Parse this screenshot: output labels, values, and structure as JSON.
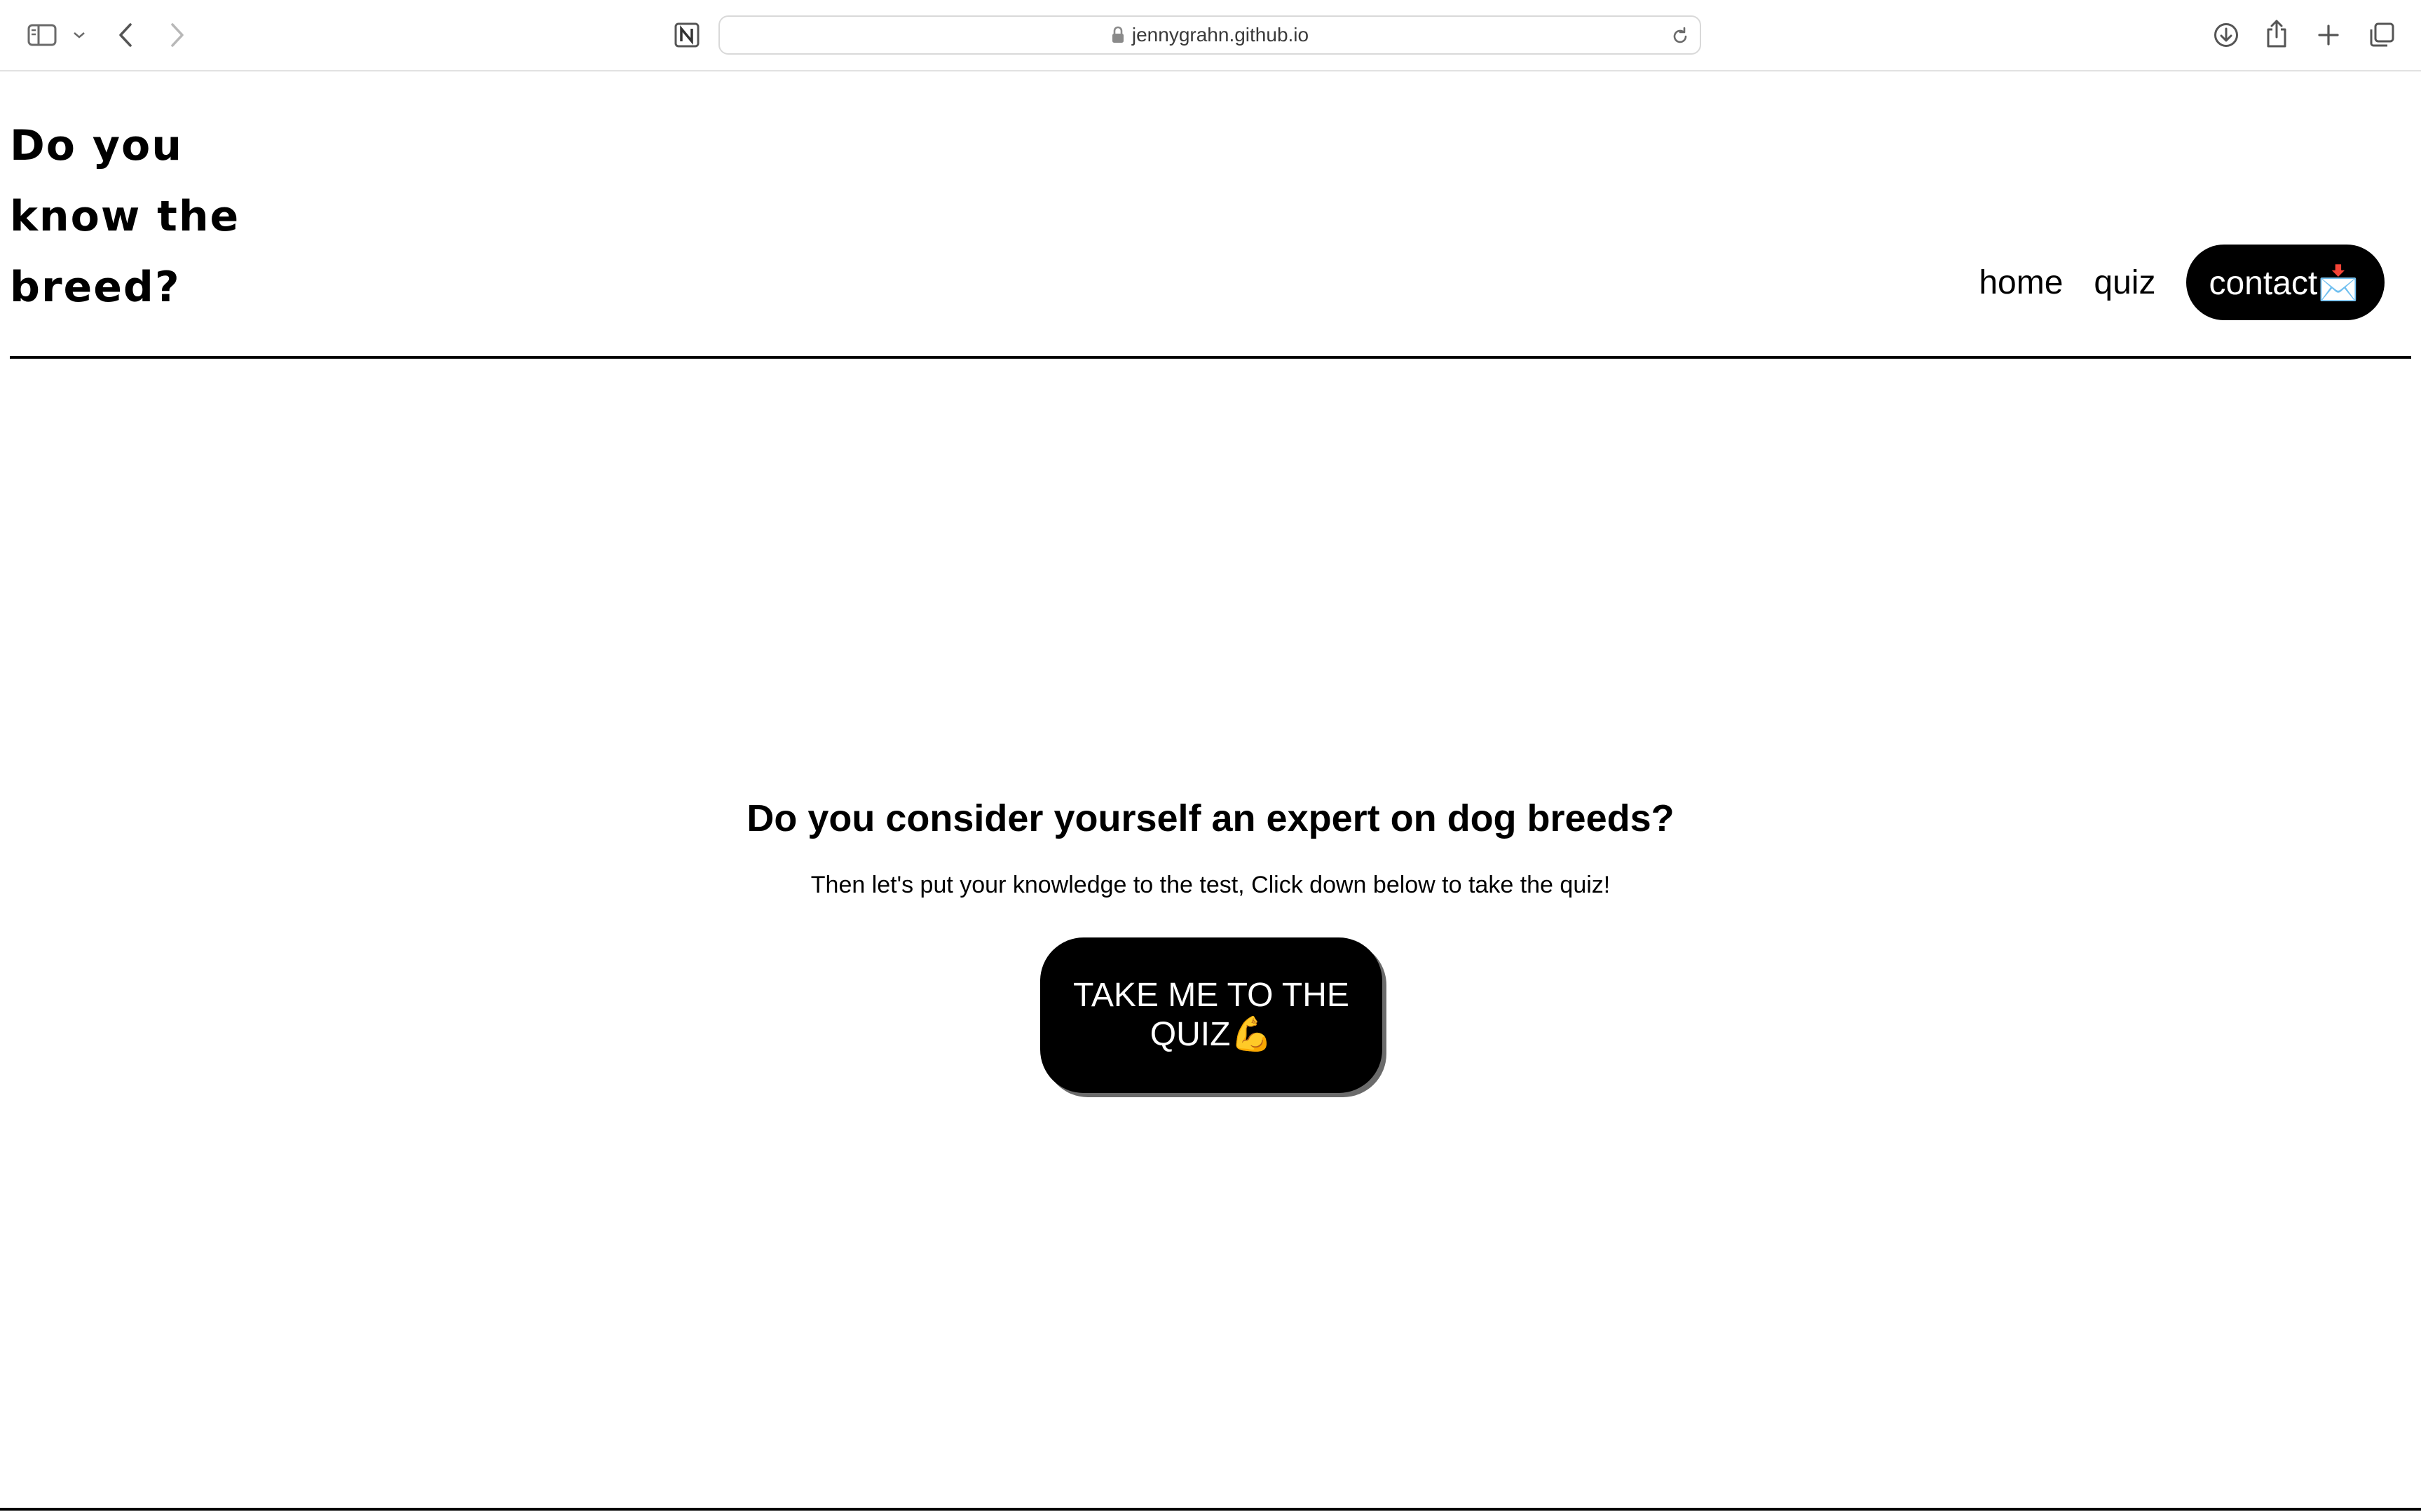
{
  "browser": {
    "address": "jennygrahn.github.io",
    "icons": {
      "sidebar": "sidebar-icon",
      "sidebar_menu": "chevron-down-icon",
      "back": "back-icon",
      "forward": "forward-icon",
      "extension": "notion-icon",
      "lock": "lock-icon",
      "reload": "reload-icon",
      "downloads": "download-icon",
      "share": "share-icon",
      "new_tab": "plus-icon",
      "tabs": "tab-overview-icon"
    }
  },
  "site": {
    "logo": "Do you know the breed?",
    "nav": {
      "home": "home",
      "quiz": "quiz",
      "contact": "contact📩"
    }
  },
  "hero": {
    "title": "Do you consider yourself an expert on dog breeds?",
    "text": "Then let's put your knowledge to the test, Click down below to take the quiz!",
    "cta": "TAKE ME TO THE QUIZ💪"
  }
}
